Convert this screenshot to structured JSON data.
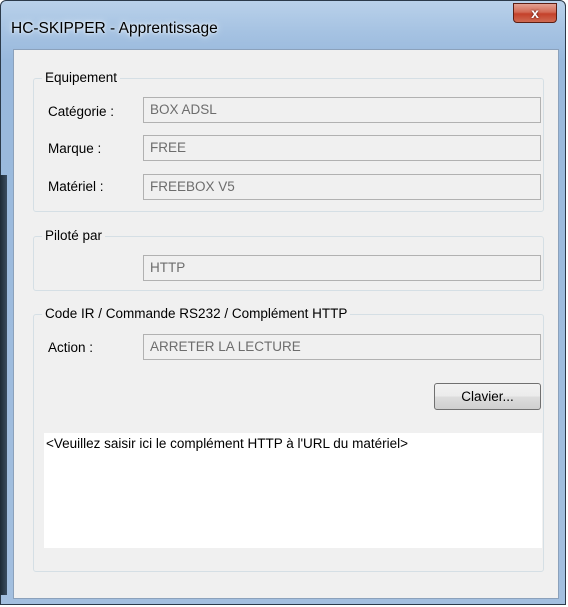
{
  "window": {
    "title": "HC-SKIPPER - Apprentissage",
    "close_glyph": "x"
  },
  "equipement": {
    "legend": "Equipement",
    "categorie_label": "Catégorie :",
    "categorie_value": "BOX ADSL",
    "marque_label": "Marque :",
    "marque_value": "FREE",
    "materiel_label": "Matériel :",
    "materiel_value": "FREEBOX V5"
  },
  "pilote": {
    "legend": "Piloté par",
    "value": "HTTP"
  },
  "code": {
    "legend": "Code IR / Commande RS232 / Complément HTTP",
    "action_label": "Action :",
    "action_value": "ARRETER LA LECTURE",
    "clavier_label": "Clavier...",
    "text": "<Veuillez saisir ici le complément HTTP à l'URL du matériel>"
  },
  "colors": {
    "title_bar": "#a5c2e2",
    "close_button": "#c4412a",
    "client_bg": "#f0f0f0"
  },
  "icons": {
    "close": "close-icon"
  }
}
